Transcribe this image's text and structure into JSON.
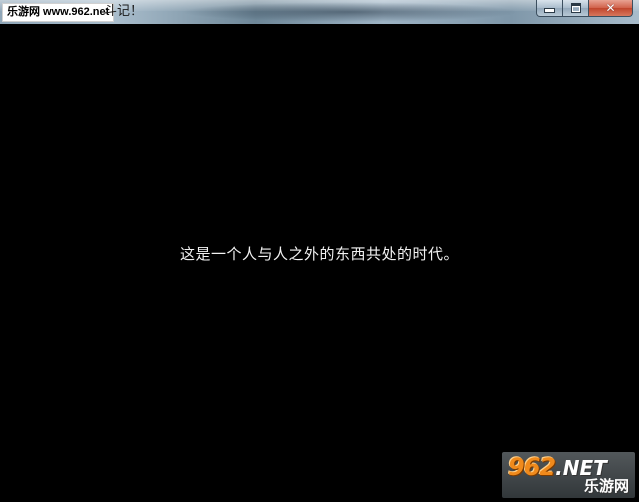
{
  "window": {
    "title_watermark": "乐游网 www.962.net",
    "title_tail": "斗记！",
    "controls": {
      "minimize_icon": "minimize-icon",
      "maximize_icon": "maximize-icon",
      "close_icon": "close-icon",
      "close_glyph": "✕"
    }
  },
  "game": {
    "story_line": "这是一个人与人之外的东西共处的时代。"
  },
  "watermark": {
    "number": "962",
    "domain": ".NET",
    "subtitle": "乐游网"
  },
  "colors": {
    "background": "#000000",
    "text": "#f2f2f2",
    "logo_orange": "#f08a1c",
    "close_button": "#c0452c"
  }
}
